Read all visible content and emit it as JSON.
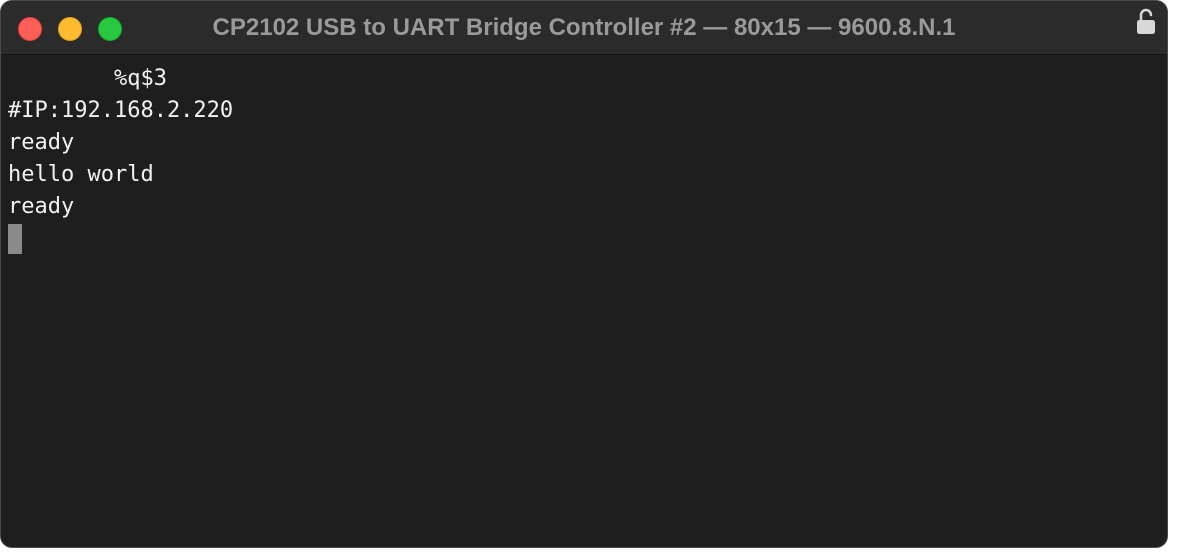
{
  "window": {
    "title": "CP2102 USB to UART Bridge Controller #2 — 80x15 — 9600.8.N.1",
    "buttons": {
      "close": "close-button",
      "minimize": "minimize-button",
      "zoom": "zoom-button"
    },
    "lock_icon": "lock-open-icon"
  },
  "terminal": {
    "lines": [
      "        %q$3",
      "#IP:192.168.2.220",
      "ready",
      "hello world",
      "ready"
    ]
  },
  "colors": {
    "close": "#ff5f57",
    "minimize": "#febc2e",
    "zoom": "#28c840",
    "background": "#1e1e1e",
    "titlebar": "#2b2b2b",
    "text": "#f2f2f2",
    "cursor": "#8a8a8a"
  }
}
